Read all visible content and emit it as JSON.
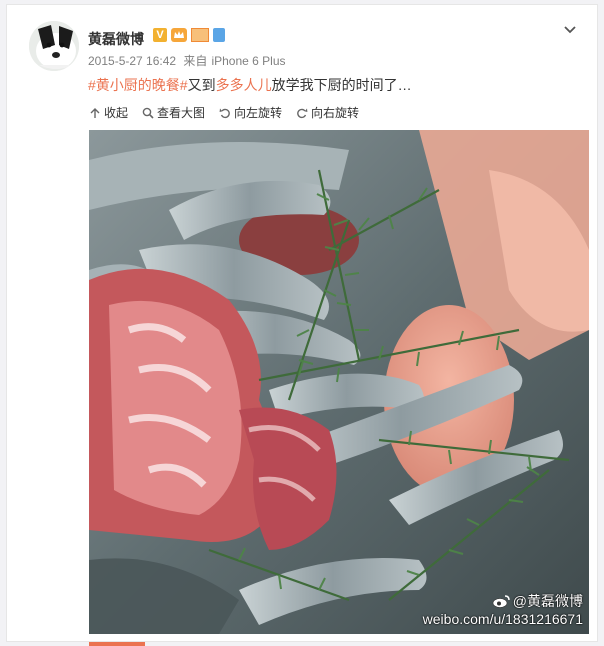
{
  "post": {
    "author": "黄磊微博",
    "badge_v": "V",
    "date": "2015-5-27 16:42",
    "source_prefix": "来自",
    "source": "iPhone 6 Plus",
    "hashtag": "#黄小厨的晚餐#",
    "text_before_mention": "又到",
    "mention": "多多人儿",
    "text_after_mention": "放学我下厨的时间了",
    "ellipsis": "…"
  },
  "toolbar": {
    "collapse_label": "收起",
    "view_large_label": "查看大图",
    "rotate_left_label": "向左旋转",
    "rotate_right_label": "向右旋转"
  },
  "image": {
    "watermark_handle": "@黄磊微博",
    "watermark_url": "weibo.com/u/1831216671"
  },
  "colors": {
    "link": "#eb7350",
    "badge_gold": "#f2b130"
  },
  "icons": [
    "chevron-down-icon",
    "collapse-icon",
    "search-icon",
    "rotate-left-icon",
    "rotate-right-icon",
    "weibo-logo-icon"
  ]
}
